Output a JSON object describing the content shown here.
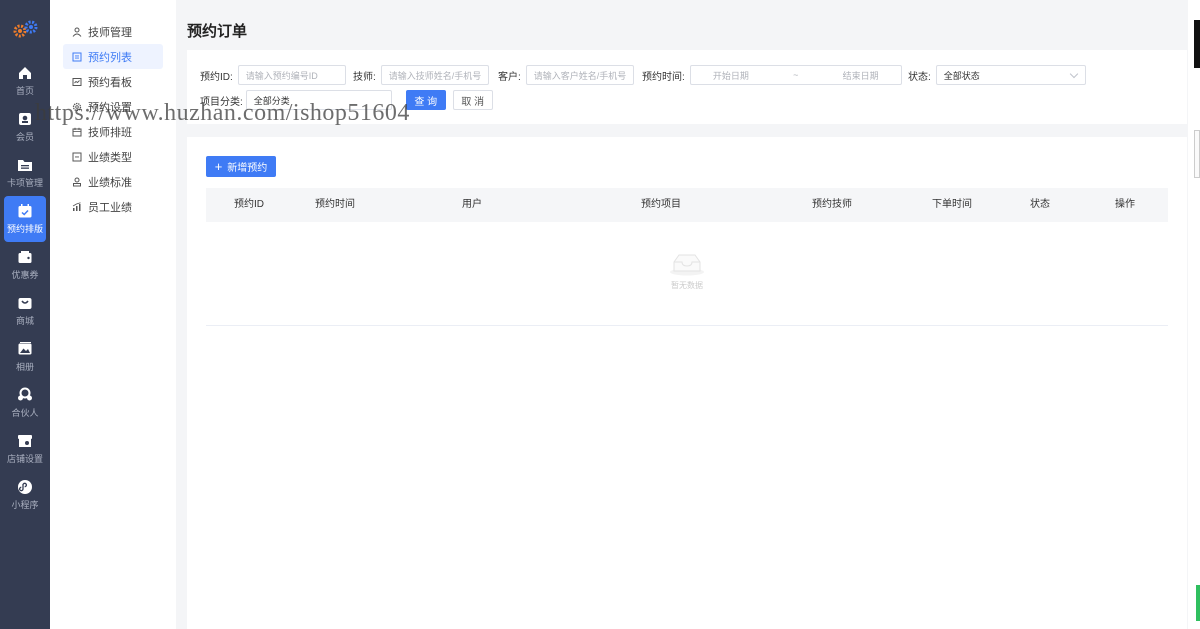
{
  "rail": {
    "items": [
      {
        "label": "首页",
        "icon": "home-icon"
      },
      {
        "label": "会员",
        "icon": "member-icon"
      },
      {
        "label": "卡项管理",
        "icon": "folder-icon"
      },
      {
        "label": "预约排版",
        "icon": "calendar-icon",
        "active": true
      },
      {
        "label": "优惠券",
        "icon": "wallet-icon"
      },
      {
        "label": "商城",
        "icon": "mall-icon"
      },
      {
        "label": "相册",
        "icon": "album-icon"
      },
      {
        "label": "合伙人",
        "icon": "partner-icon"
      },
      {
        "label": "店铺设置",
        "icon": "store-icon"
      },
      {
        "label": "小程序",
        "icon": "miniprogram-icon"
      }
    ]
  },
  "subnav": {
    "items": [
      {
        "label": "技师管理",
        "icon": "user-icon"
      },
      {
        "label": "预约列表",
        "icon": "list-icon",
        "active": true
      },
      {
        "label": "预约看板",
        "icon": "board-icon"
      },
      {
        "label": "预约设置",
        "icon": "settings-icon"
      },
      {
        "label": "技师排班",
        "icon": "schedule-icon"
      },
      {
        "label": "业绩类型",
        "icon": "type-icon"
      },
      {
        "label": "业绩标准",
        "icon": "standard-icon"
      },
      {
        "label": "员工业绩",
        "icon": "chart-icon"
      }
    ]
  },
  "page": {
    "title": "预约订单"
  },
  "filters": {
    "id_label": "预约ID:",
    "id_placeholder": "请输入预约编号ID",
    "tech_label": "技师:",
    "tech_placeholder": "请输入技师姓名/手机号",
    "customer_label": "客户:",
    "customer_placeholder": "请输入客户姓名/手机号",
    "time_label": "预约时间:",
    "time_start": "开始日期",
    "time_sep": "~",
    "time_end": "结束日期",
    "status_label": "状态:",
    "status_value": "全部状态",
    "category_label": "项目分类:",
    "category_value": "全部分类",
    "search_button": "查 询",
    "cancel_button": "取 消"
  },
  "list": {
    "add_button": "新增预约",
    "columns": [
      "预约ID",
      "预约时间",
      "用户",
      "预约项目",
      "预约技师",
      "下单时间",
      "状态",
      "操作"
    ],
    "empty_text": "暂无数据"
  },
  "watermark": "https://www.huzhan.com/ishop51604",
  "colors": {
    "accent": "#3f7bf5",
    "rail": "#343c52"
  }
}
